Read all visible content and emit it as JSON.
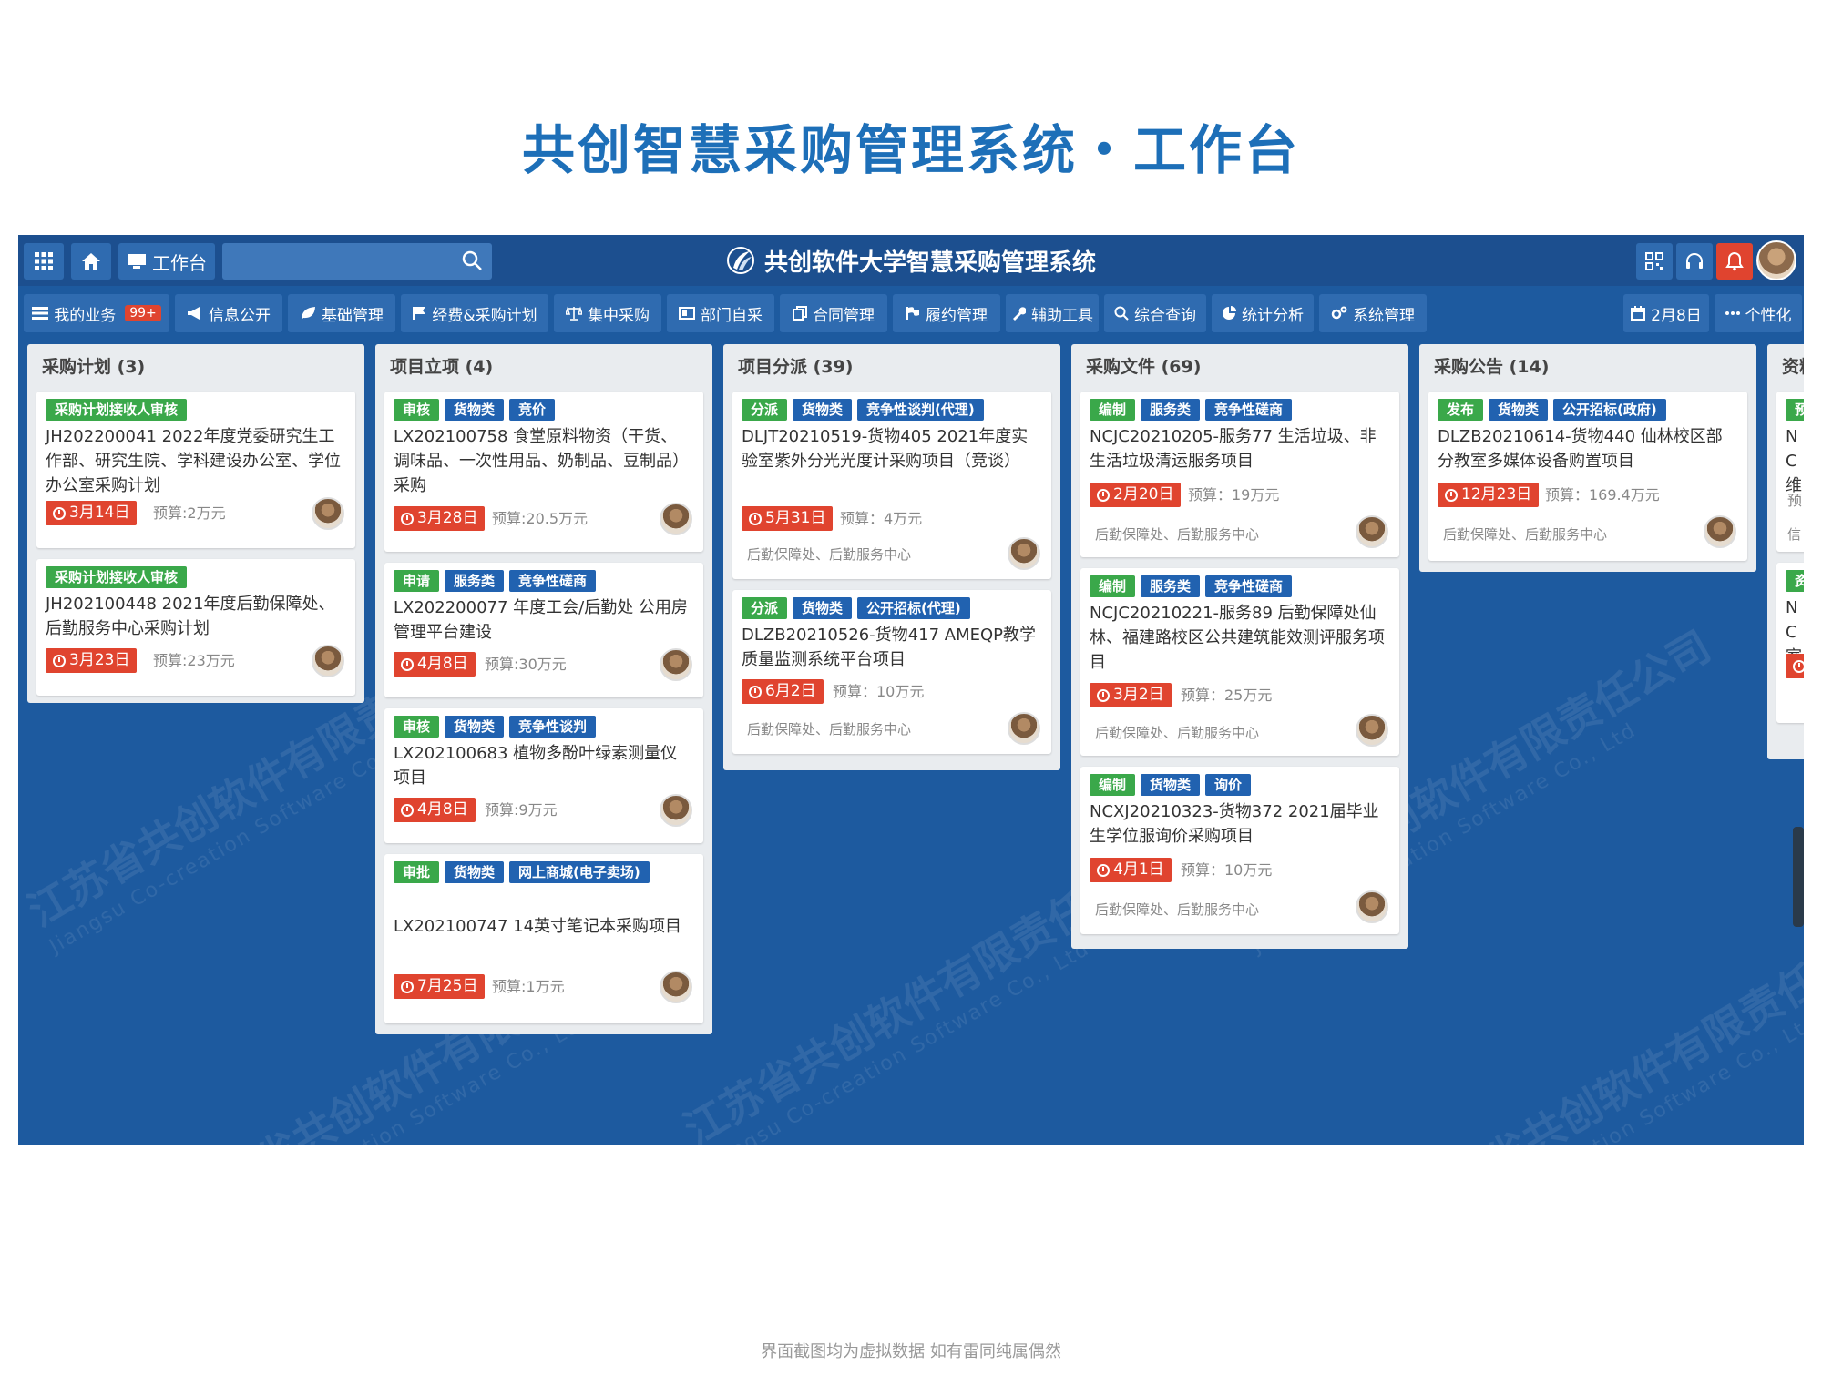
{
  "page_title": "共创智慧采购管理系统・工作台",
  "footnote": "界面截图均为虚拟数据 如有雷同纯属偶然",
  "topbar": {
    "workbench_label": "工作台",
    "search_placeholder": "",
    "app_name": "共创软件大学智慧采购管理系统",
    "icons": [
      "grid-icon",
      "home-icon",
      "monitor-icon",
      "search-icon",
      "qrcode-icon",
      "headset-icon",
      "bell-icon"
    ]
  },
  "watermark": {
    "company_cn": "江苏省共创软件有限责任公司",
    "company_en": "Jiangsu Co-creation Software Co., Ltd"
  },
  "nav": {
    "my_business": "我的业务",
    "my_business_badge": "99+",
    "items": [
      "信息公开",
      "基础管理",
      "经费&采购计划",
      "集中采购",
      "部门自采",
      "合同管理",
      "履约管理",
      "辅助工具",
      "综合查询",
      "统计分析",
      "系统管理"
    ],
    "date_label": "2月8日",
    "personalize_label": "个性化"
  },
  "columns": [
    {
      "title": "采购计划 (3)",
      "cards": [
        {
          "tags": [
            "采购计划接收人审核"
          ],
          "title": "JH202200041 2022年度党委研究生工作部、研究生院、学科建设办公室、学位办公室采购计划",
          "date": "3月14日",
          "budget": "预算:2万元",
          "dept": ""
        },
        {
          "tags": [
            "采购计划接收人审核"
          ],
          "title": "JH202100448 2021年度后勤保障处、后勤服务中心采购计划",
          "date": "3月23日",
          "budget": "预算:23万元",
          "dept": ""
        }
      ]
    },
    {
      "title": "项目立项 (4)",
      "cards": [
        {
          "tags": [
            "审核",
            "货物类",
            "竞价"
          ],
          "title": "LX202100758 食堂原料物资（干货、调味品、一次性用品、奶制品、豆制品）采购",
          "date": "3月28日",
          "budget": "预算:20.5万元",
          "dept": ""
        },
        {
          "tags": [
            "申请",
            "服务类",
            "竞争性磋商"
          ],
          "title": "LX202200077 年度工会/后勤处 公用房管理平台建设",
          "date": "4月8日",
          "budget": "预算:30万元",
          "dept": ""
        },
        {
          "tags": [
            "审核",
            "货物类",
            "竞争性谈判"
          ],
          "title": "LX202100683 植物多酚叶绿素测量仪项目",
          "date": "4月8日",
          "budget": "预算:9万元",
          "dept": ""
        },
        {
          "tags": [
            "审批",
            "货物类",
            "网上商城(电子卖场)"
          ],
          "title": "LX202100747 14英寸笔记本采购项目",
          "date": "7月25日",
          "budget": "预算:1万元",
          "dept": ""
        }
      ]
    },
    {
      "title": "项目分派 (39)",
      "cards": [
        {
          "tags": [
            "分派",
            "货物类",
            "竞争性谈判(代理)"
          ],
          "title": "DLJT20210519-货物405 2021年度实验室紫外分光光度计采购项目（竞谈）",
          "date": "5月31日",
          "budget": "预算：4万元",
          "dept": "后勤保障处、后勤服务中心"
        },
        {
          "tags": [
            "分派",
            "货物类",
            "公开招标(代理)"
          ],
          "title": "DLZB20210526-货物417 AMEQP教学质量监测系统平台项目",
          "date": "6月2日",
          "budget": "预算：10万元",
          "dept": "后勤保障处、后勤服务中心"
        }
      ]
    },
    {
      "title": "采购文件 (69)",
      "cards": [
        {
          "tags": [
            "编制",
            "服务类",
            "竞争性磋商"
          ],
          "title": "NCJC20210205-服务77 生活垃圾、非生活垃圾清运服务项目",
          "date": "2月20日",
          "budget": "预算：19万元",
          "dept": "后勤保障处、后勤服务中心"
        },
        {
          "tags": [
            "编制",
            "服务类",
            "竞争性磋商"
          ],
          "title": "NCJC20210221-服务89 后勤保障处仙林、福建路校区公共建筑能效测评服务项目",
          "date": "3月2日",
          "budget": "预算：25万元",
          "dept": "后勤保障处、后勤服务中心"
        },
        {
          "tags": [
            "编制",
            "货物类",
            "询价"
          ],
          "title": "NCXJ20210323-货物372 2021届毕业生学位服询价采购项目",
          "date": "4月1日",
          "budget": "预算：10万元",
          "dept": "后勤保障处、后勤服务中心"
        }
      ]
    },
    {
      "title": "采购公告 (14)",
      "cards": [
        {
          "tags": [
            "发布",
            "货物类",
            "公开招标(政府)"
          ],
          "title": "DLZB20210614-货物440 仙林校区部分教室多媒体设备购置项目",
          "date": "12月23日",
          "budget": "预算：169.4万元",
          "dept": "后勤保障处、后勤服务中心"
        }
      ]
    },
    {
      "title": "资料",
      "cards": [
        {
          "tags": [
            "预"
          ],
          "title": "NC维",
          "date": "",
          "budget": "预",
          "dept": "信"
        },
        {
          "tags": [
            "资"
          ],
          "title": "NC室",
          "date": " ",
          "budget": "",
          "dept": ""
        }
      ]
    }
  ],
  "colors": {
    "brand": "#1d6fb8",
    "app_bg": "#1d5a9f",
    "tag_green": "#3aa84a",
    "tag_blue": "#2162b0",
    "date_red": "#e0442f"
  }
}
